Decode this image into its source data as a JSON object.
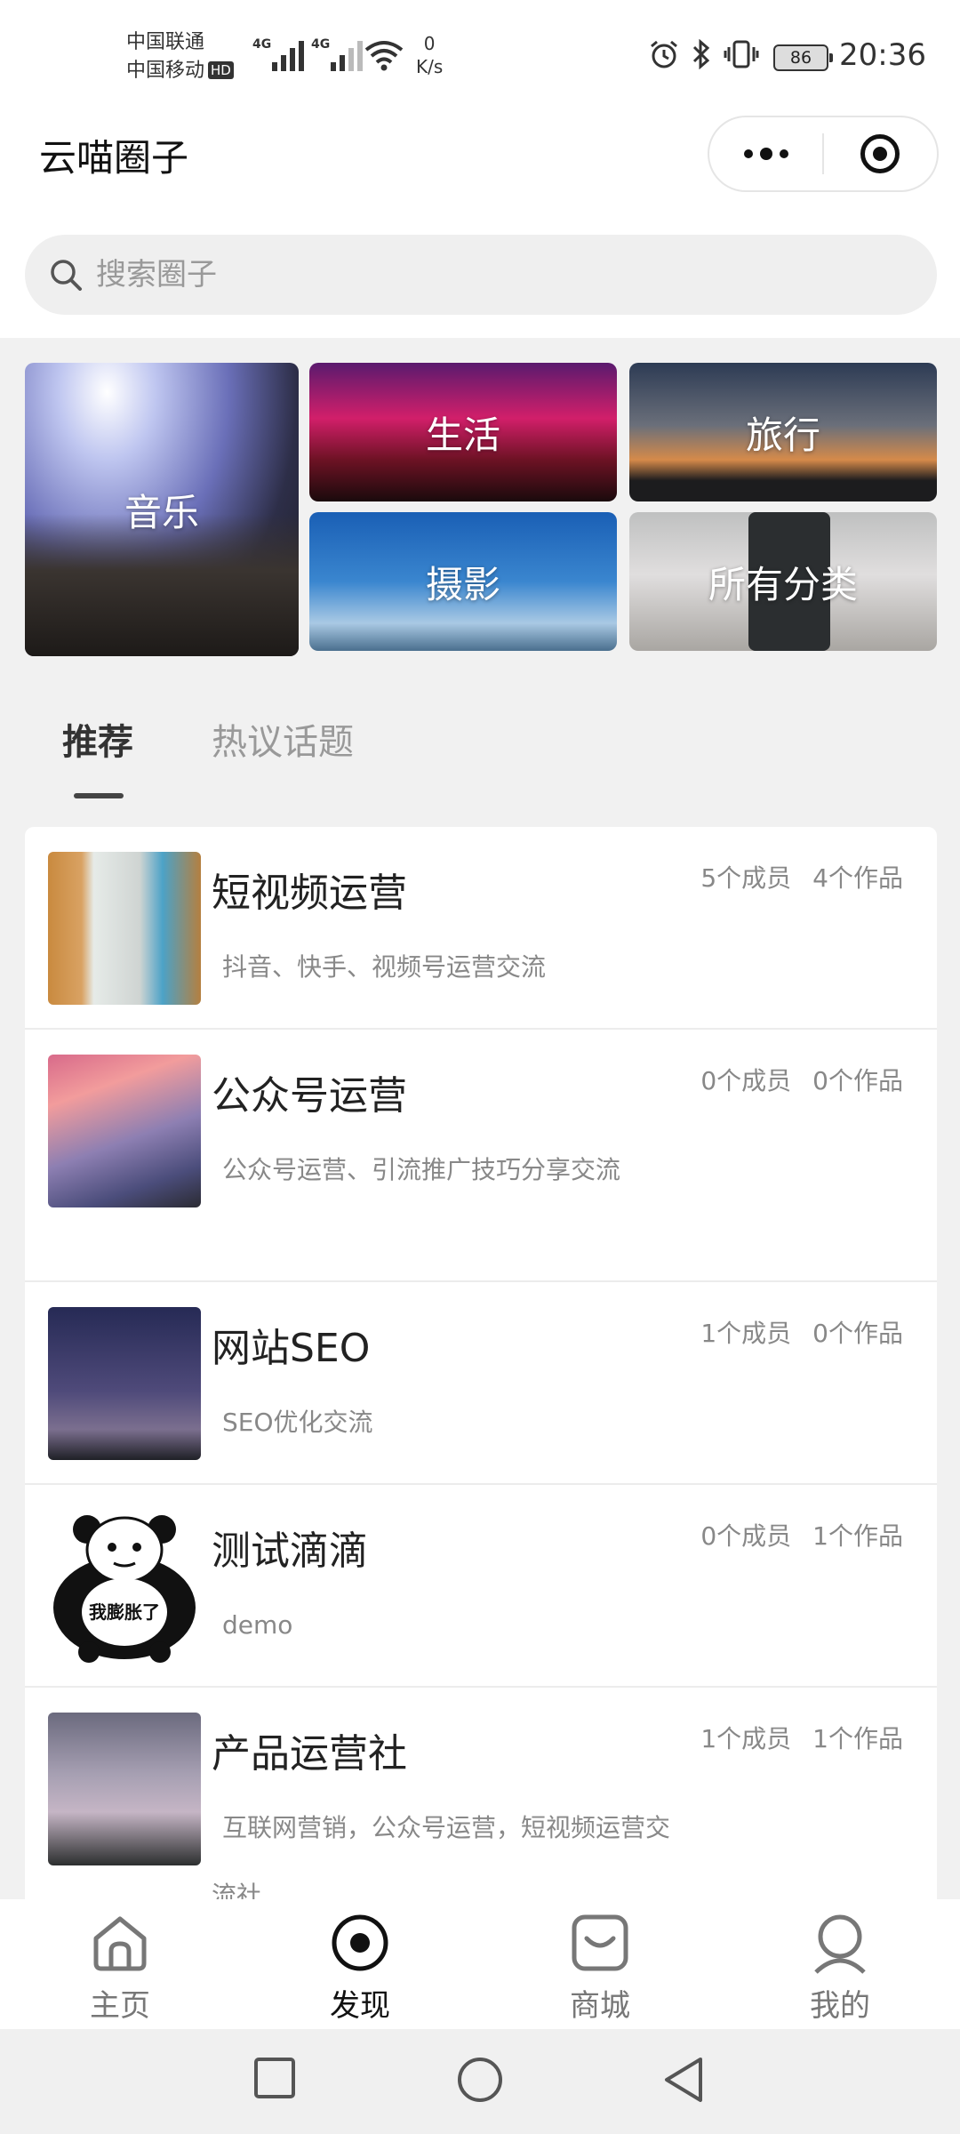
{
  "status_bar": {
    "carrier1": "中国联通",
    "carrier2": "中国移动",
    "hd_badge": "HD",
    "net1": "4G",
    "net2": "4G",
    "speed_value": "0",
    "speed_unit": "K/s",
    "battery": "86",
    "time": "20:36"
  },
  "header": {
    "title": "云喵圈子"
  },
  "search": {
    "placeholder": "搜索圈子"
  },
  "categories": [
    {
      "label": "音乐"
    },
    {
      "label": "生活"
    },
    {
      "label": "旅行"
    },
    {
      "label": "摄影"
    },
    {
      "label": "所有分类"
    }
  ],
  "tabs": [
    {
      "label": "推荐",
      "active": true
    },
    {
      "label": "热议话题",
      "active": false
    }
  ],
  "circles": [
    {
      "name": "短视频运营",
      "members": "5个成员",
      "works": "4个作品",
      "desc": "抖音、快手、视频号运营交流"
    },
    {
      "name": "公众号运营",
      "members": "0个成员",
      "works": "0个作品",
      "desc": "公众号运营、引流推广技巧分享交流"
    },
    {
      "name": "网站SEO",
      "members": "1个成员",
      "works": "0个作品",
      "desc": "SEO优化交流"
    },
    {
      "name": "测试滴滴",
      "members": "0个成员",
      "works": "1个作品",
      "desc": "demo",
      "thumb_text": "我膨胀了"
    },
    {
      "name": "产品运营社",
      "members": "1个成员",
      "works": "1个作品",
      "desc": "互联网营销，公众号运营，短视频运营交流社"
    }
  ],
  "bottom_nav": [
    {
      "label": "主页",
      "icon": "home-icon",
      "active": false
    },
    {
      "label": "发现",
      "icon": "discover-icon",
      "active": true
    },
    {
      "label": "商城",
      "icon": "shop-bag-icon",
      "active": false
    },
    {
      "label": "我的",
      "icon": "profile-icon",
      "active": false
    }
  ],
  "colors": {
    "active": "#111111",
    "inactive": "#777777",
    "muted_text": "#888888",
    "background": "#f1f1f1"
  }
}
